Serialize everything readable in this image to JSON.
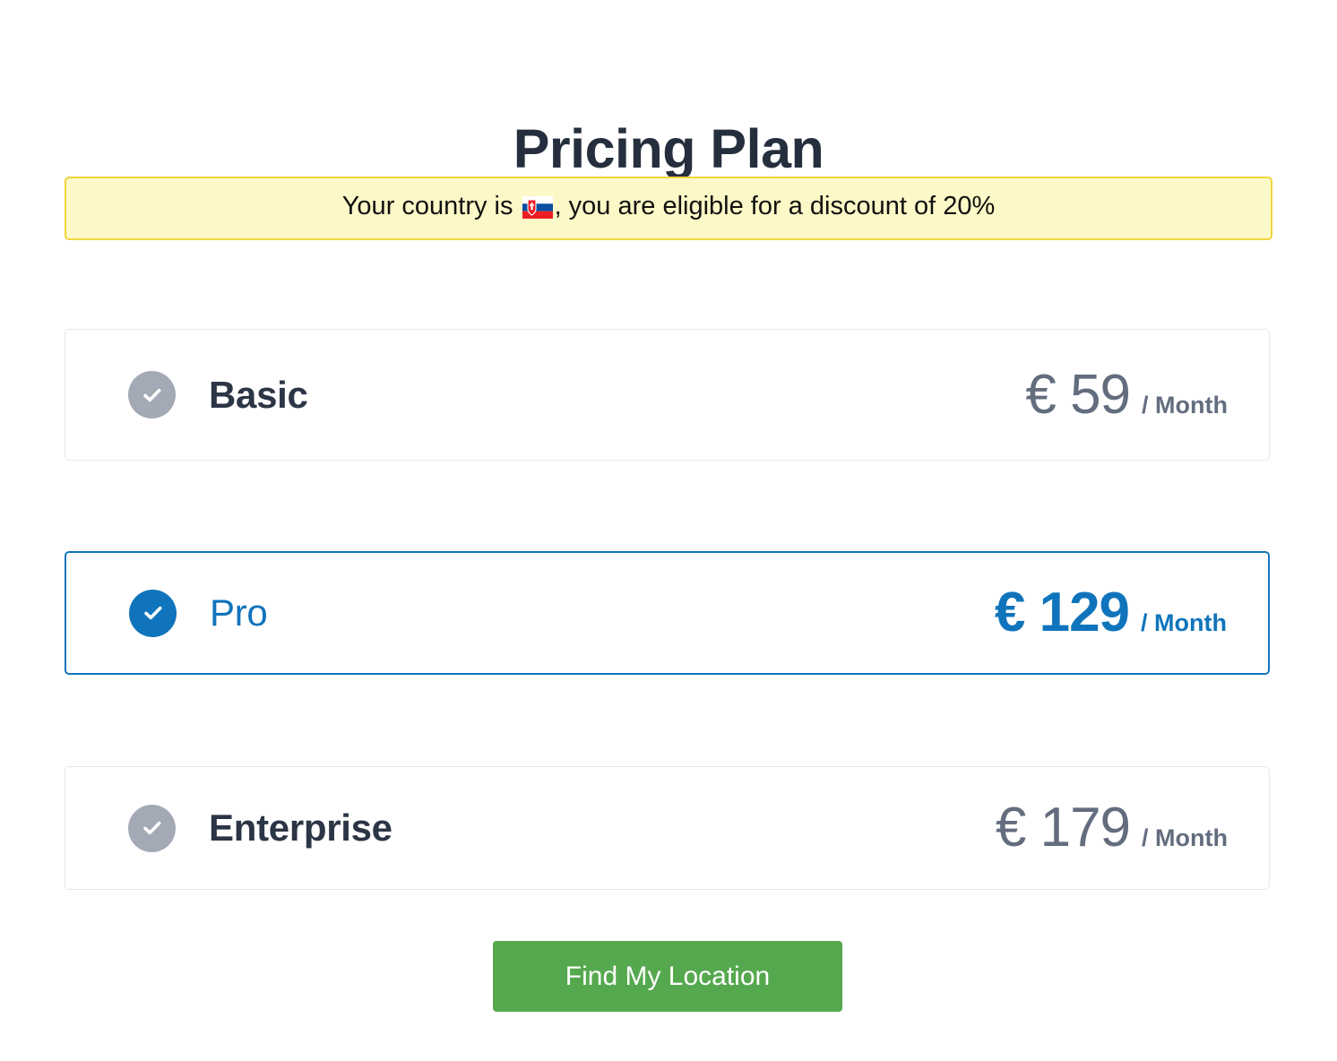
{
  "page": {
    "title": "Pricing Plan"
  },
  "alert": {
    "text_before_flag": "Your country is ",
    "flag": "🇸🇰",
    "flag_name": "slovakia-flag",
    "text_after_flag": ", you are eligible for a discount of 20%",
    "discount_percent": "20%",
    "country": "Slovakia",
    "background_color": "#fcf8c7",
    "border_color": "#f0d541"
  },
  "plans": [
    {
      "name": "Basic",
      "currency": "€",
      "amount": "59",
      "price_display": "€ 59",
      "period": "/ Month",
      "selected": false,
      "color": "#636d7e",
      "icon": "check-circle-icon"
    },
    {
      "name": "Pro",
      "currency": "€",
      "amount": "129",
      "price_display": "€ 129",
      "period": "/ Month",
      "selected": true,
      "color": "#1074bc",
      "icon": "check-circle-icon"
    },
    {
      "name": "Enterprise",
      "currency": "€",
      "amount": "179",
      "price_display": "€ 179",
      "period": "/ Month",
      "selected": false,
      "color": "#636d7e",
      "icon": "check-circle-icon"
    }
  ],
  "cta": {
    "label": "Find My Location",
    "background_color": "#55a84e"
  }
}
